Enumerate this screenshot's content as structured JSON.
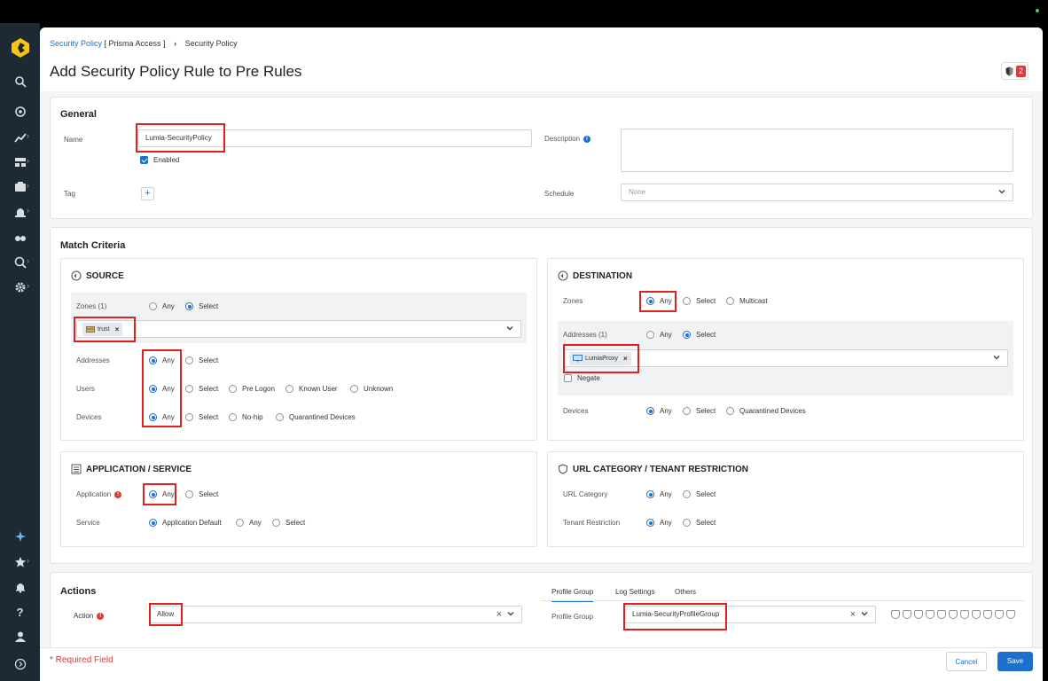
{
  "breadcrumb": {
    "link": "Security Policy",
    "scope": "[ Prisma Access ]",
    "current": "Security Policy"
  },
  "page_title": "Add Security Policy Rule to Pre Rules",
  "badge_count": "2",
  "general": {
    "title": "General",
    "name_label": "Name",
    "name_value": "Lumia-SecurityPolicy",
    "enabled_label": "Enabled",
    "tag_label": "Tag",
    "tag_add": "+",
    "description_label": "Description",
    "description_info": "i",
    "schedule_label": "Schedule",
    "schedule_value": "None"
  },
  "match": {
    "title": "Match Criteria",
    "source": {
      "title": "SOURCE",
      "zones_label": "Zones (1)",
      "zones_any": "Any",
      "zones_select": "Select",
      "zone_tag": "trust",
      "addresses_label": "Addresses",
      "addresses_any": "Any",
      "addresses_select": "Select",
      "users_label": "Users",
      "users_options": [
        "Any",
        "Select",
        "Pre Logon",
        "Known User",
        "Unknown"
      ],
      "devices_label": "Devices",
      "devices_options": [
        "Any",
        "Select",
        "No-hip",
        "Quarantined Devices"
      ]
    },
    "destination": {
      "title": "DESTINATION",
      "zones_label": "Zones",
      "zones_options": [
        "Any",
        "Select",
        "Multicast"
      ],
      "addresses_label": "Addresses (1)",
      "addresses_any": "Any",
      "addresses_select": "Select",
      "address_tag": "LumiaProxy",
      "negate_label": "Negate",
      "devices_label": "Devices",
      "devices_options": [
        "Any",
        "Select",
        "Quarantined Devices"
      ]
    },
    "app_service": {
      "title": "APPLICATION / SERVICE",
      "application_label": "Application",
      "application_any": "Any",
      "application_select": "Select",
      "service_label": "Service",
      "service_options": [
        "Application Default",
        "Any",
        "Select"
      ]
    },
    "url": {
      "title": "URL CATEGORY / TENANT RESTRICTION",
      "url_label": "URL Category",
      "url_any": "Any",
      "url_select": "Select",
      "tenant_label": "Tenant Restriction",
      "tenant_any": "Any",
      "tenant_select": "Select"
    }
  },
  "actions": {
    "title": "Actions",
    "action_label": "Action",
    "action_value": "Allow",
    "tabs": [
      "Profile Group",
      "Log Settings",
      "Others"
    ],
    "profile_group_label": "Profile Group",
    "profile_group_value": "Lumia-SecurityProfileGroup"
  },
  "footer": {
    "required": "* Required Field",
    "cancel": "Cancel",
    "save": "Save"
  },
  "colors": {
    "accent": "#1a6fcf",
    "highlight": "#e0201c",
    "nav": "#1d2a33"
  }
}
